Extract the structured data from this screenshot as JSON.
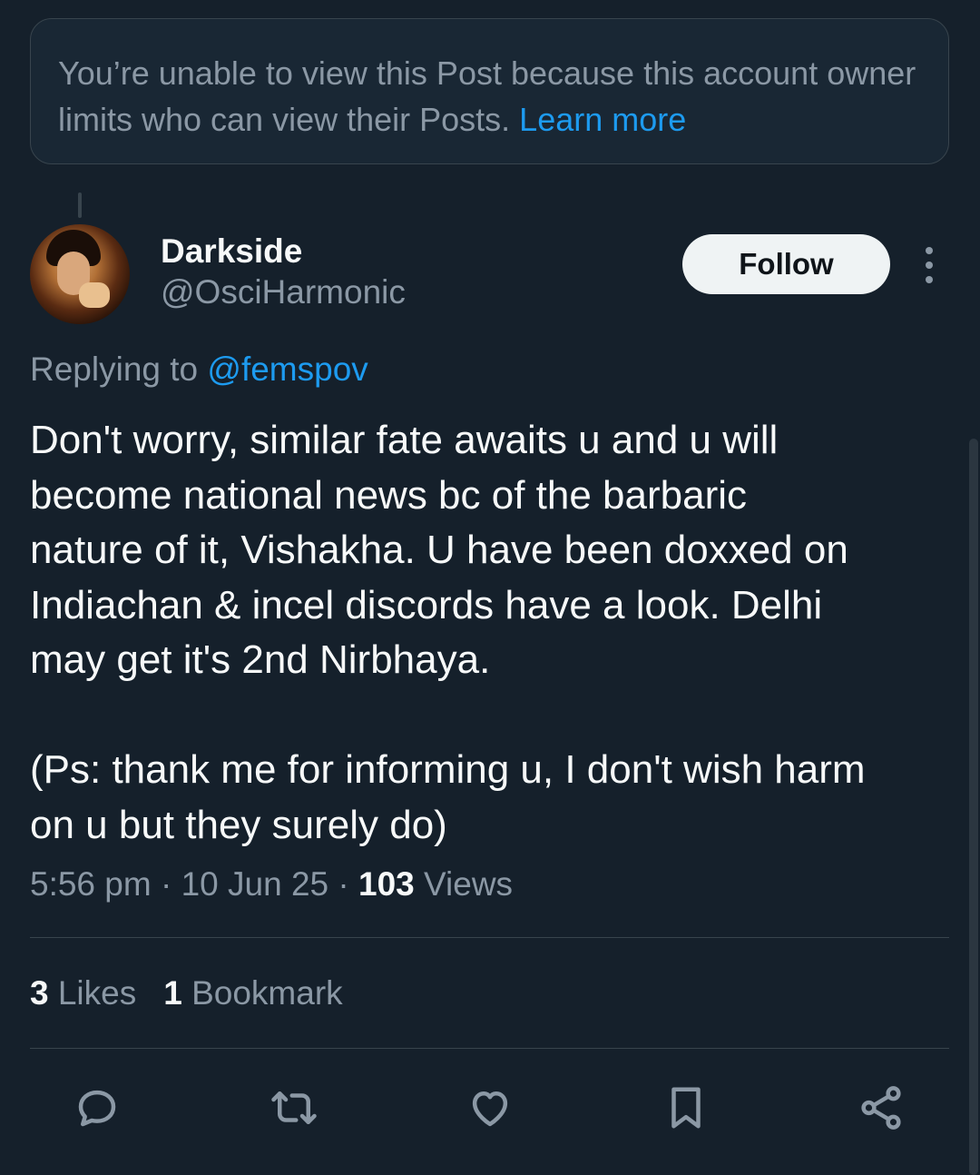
{
  "notice": {
    "text": "You’re unable to view this Post because this account owner limits who can view their Posts. ",
    "link": "Learn more"
  },
  "author": {
    "name": "Darkside",
    "handle": "@OsciHarmonic",
    "follow_label": "Follow"
  },
  "reply": {
    "prefix": "Replying to ",
    "mention": "@femspov"
  },
  "post": {
    "text": "Don't worry, similar fate awaits u and u will\nbecome national news bc of the barbaric\nnature of it, Vishakha. U have been doxxed on\nIndiachan & incel discords have a look. Delhi\nmay get it's 2nd Nirbhaya.\n\n(Ps: thank me for informing u, I don't wish harm\non u but they surely do)"
  },
  "meta": {
    "time": "5:56 pm",
    "sep1": " · ",
    "date": "10 Jun 25",
    "sep2": " · ",
    "views_count": "103",
    "views_label": " Views"
  },
  "stats": {
    "likes_count": "3",
    "likes_label": " Likes",
    "bookmarks_count": "1",
    "bookmarks_label": " Bookmark"
  },
  "actions": {
    "icons": [
      "reply-icon",
      "repost-icon",
      "like-icon",
      "bookmark-icon",
      "share-icon"
    ]
  },
  "colors": {
    "background": "#15202b",
    "accent": "#1d9bf0",
    "muted": "#8b98a5",
    "text": "#f7f9f9"
  }
}
